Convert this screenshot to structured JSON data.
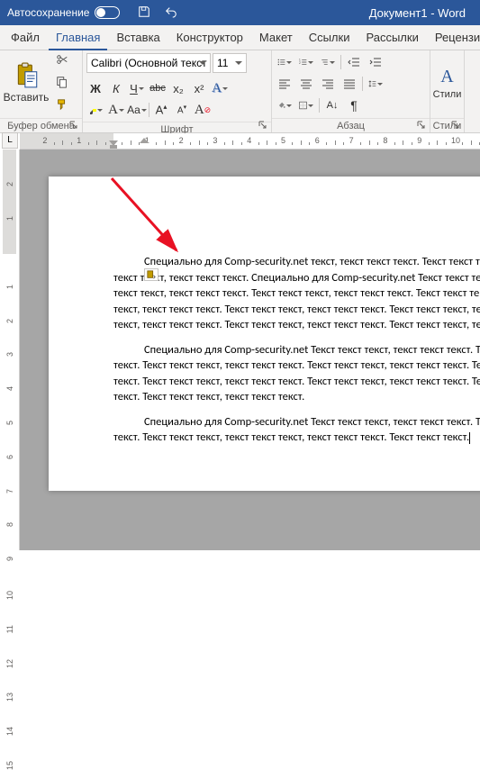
{
  "title_bar": {
    "autosave_label": "Автосохранение",
    "document_title": "Документ1  -  Word"
  },
  "tabs": {
    "file": "Файл",
    "home": "Главная",
    "insert": "Вставка",
    "design": "Конструктор",
    "layout": "Макет",
    "references": "Ссылки",
    "mailings": "Рассылки",
    "review": "Рецензирова"
  },
  "ribbon": {
    "clipboard": {
      "label": "Буфер обмена",
      "paste": "Вставить"
    },
    "font": {
      "label": "Шрифт",
      "name": "Calibri (Основной текст",
      "size": "11",
      "bold": "Ж",
      "italic": "К",
      "underline": "Ч",
      "strike": "abc",
      "sub": "x₂",
      "sup": "x²"
    },
    "paragraph": {
      "label": "Абзац"
    },
    "styles": {
      "label": "Стили"
    }
  },
  "ruler": {
    "h_numbers": [
      "2",
      "1",
      "1",
      "2",
      "3",
      "4",
      "5",
      "6",
      "7",
      "8"
    ],
    "v_numbers": [
      "2",
      "1",
      "1",
      "2"
    ]
  },
  "document": {
    "p1": "Специально для Comp-security.net текст, текст текст текст. Текст текст текст, текст текст текст. Текст текст текст, текст текст текст. Специально для Comp-security.net Текст текст текст, текст текст текст. Текст текст текст, текст текст текст. Текст текст текст, текст текст текст. Текст текст текст, текст текст текст. Текст текст текст, текст текст текст. Текст текст текст, текст текст текст. Текст текст текст, текст текст текст. Текст текст текст, текст текст текст. Текст текст текст, текст текст текст. Текст текст текст, текст текст текст. Текст текст текст",
    "p2": "Специально для Comp-security.net Текст текст текст, текст текст текст. Текст текст текст, текст текст текст. Текст текст текст, текст текст текст. Текст текст текст, текст текст текст. Текст текст текст, текст текст текст. Текст текст текст, текст текст текст. Текст текст текст, текст текст текст. Текст текст текст, текст текст текст. Текст текст текст, текст текст текст.",
    "p3": "Специально для Comp-security.net Текст текст текст, текст текст текст. Текст текст текст, текст текст текст. Текст текст текст, текст текст текст, текст текст текст. Текст текст текст."
  }
}
